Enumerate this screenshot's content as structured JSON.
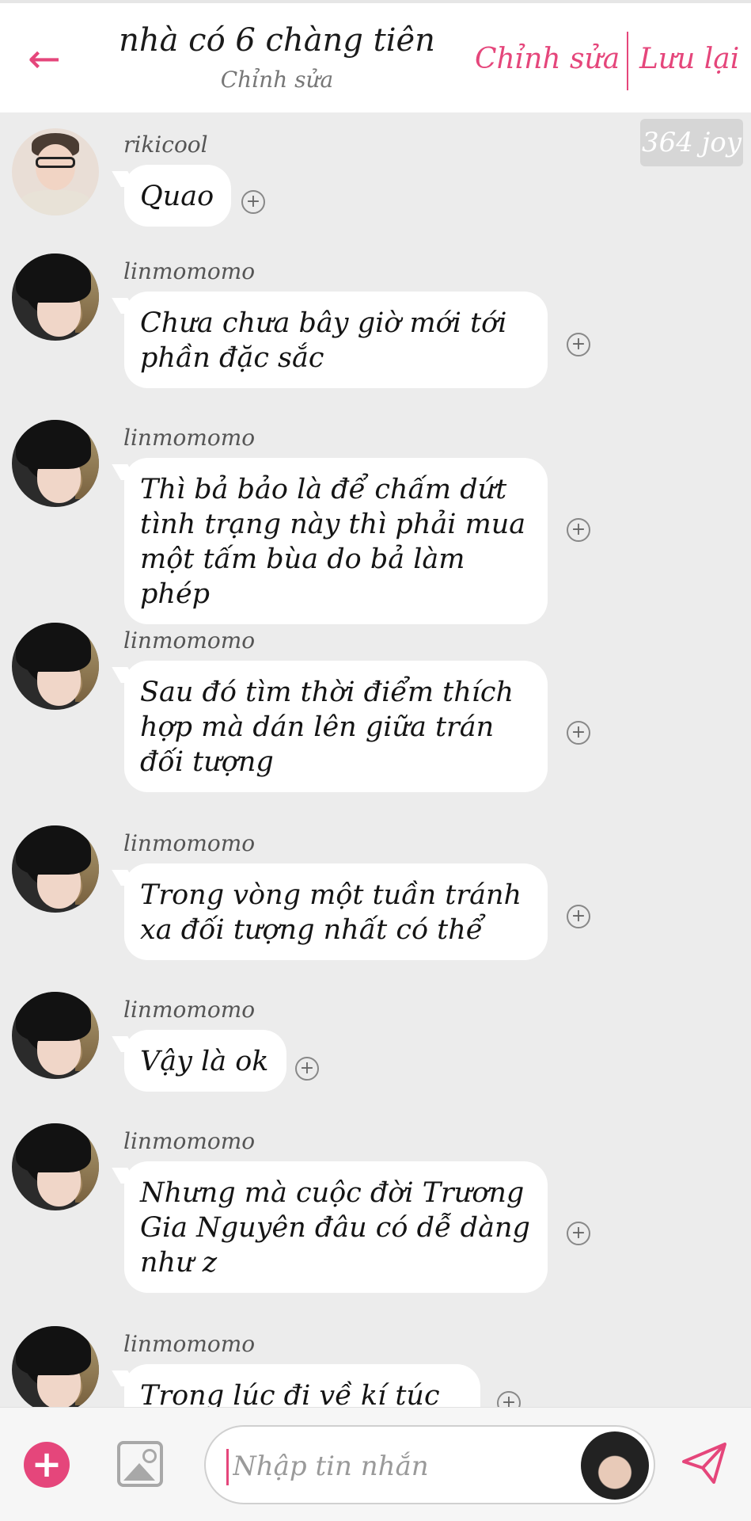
{
  "header": {
    "back_icon": "arrow-left-icon",
    "title": "nhà có 6 chàng tiên",
    "subtitle": "Chỉnh sửa",
    "edit_label": "Chỉnh sửa",
    "save_label": "Lưu lại",
    "accent_color": "#e5467b"
  },
  "badge": {
    "label": "364 joy"
  },
  "messages": [
    {
      "user": "rikicool",
      "text": "Quao"
    },
    {
      "user": "linmomomo",
      "text": "Chưa chưa bây giờ mới tới phần đặc sắc"
    },
    {
      "user": "linmomomo",
      "text": "Thì bả bảo là để chấm dứt tình trạng này thì phải mua một tấm bùa do bả làm phép"
    },
    {
      "user": "linmomomo",
      "text": "Sau đó tìm thời điểm thích hợp mà dán lên giữa trán đối tượng"
    },
    {
      "user": "linmomomo",
      "text": "Trong vòng một tuần tránh xa đối tượng nhất có thể"
    },
    {
      "user": "linmomomo",
      "text": "Vậy là ok"
    },
    {
      "user": "linmomomo",
      "text": "Nhưng mà cuộc đời Trương Gia Nguyên đâu có dễ dàng như z"
    },
    {
      "user": "linmomomo",
      "text": "Trong lúc đi về kí túc xá"
    }
  ],
  "composer": {
    "placeholder": "Nhập tin nhắn",
    "add_icon": "plus-icon",
    "image_icon": "image-icon",
    "send_icon": "send-icon"
  }
}
